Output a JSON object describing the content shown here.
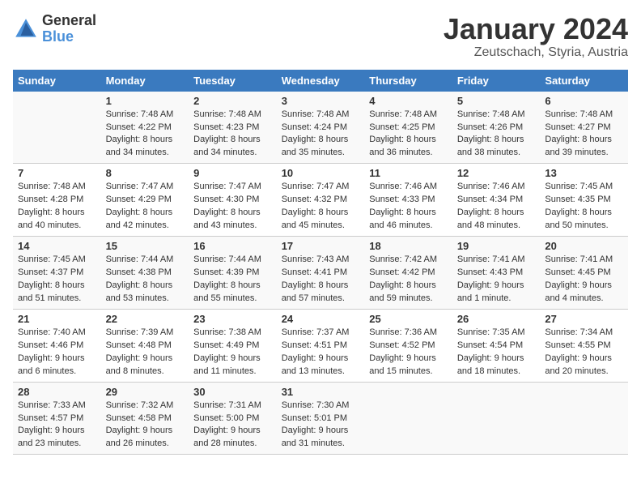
{
  "logo": {
    "general": "General",
    "blue": "Blue"
  },
  "title": "January 2024",
  "location": "Zeutschach, Styria, Austria",
  "days_of_week": [
    "Sunday",
    "Monday",
    "Tuesday",
    "Wednesday",
    "Thursday",
    "Friday",
    "Saturday"
  ],
  "weeks": [
    [
      {
        "day": "",
        "sunrise": "",
        "sunset": "",
        "daylight": ""
      },
      {
        "day": "1",
        "sunrise": "7:48 AM",
        "sunset": "4:22 PM",
        "daylight": "8 hours and 34 minutes."
      },
      {
        "day": "2",
        "sunrise": "7:48 AM",
        "sunset": "4:23 PM",
        "daylight": "8 hours and 34 minutes."
      },
      {
        "day": "3",
        "sunrise": "7:48 AM",
        "sunset": "4:24 PM",
        "daylight": "8 hours and 35 minutes."
      },
      {
        "day": "4",
        "sunrise": "7:48 AM",
        "sunset": "4:25 PM",
        "daylight": "8 hours and 36 minutes."
      },
      {
        "day": "5",
        "sunrise": "7:48 AM",
        "sunset": "4:26 PM",
        "daylight": "8 hours and 38 minutes."
      },
      {
        "day": "6",
        "sunrise": "7:48 AM",
        "sunset": "4:27 PM",
        "daylight": "8 hours and 39 minutes."
      }
    ],
    [
      {
        "day": "7",
        "sunrise": "7:48 AM",
        "sunset": "4:28 PM",
        "daylight": "8 hours and 40 minutes."
      },
      {
        "day": "8",
        "sunrise": "7:47 AM",
        "sunset": "4:29 PM",
        "daylight": "8 hours and 42 minutes."
      },
      {
        "day": "9",
        "sunrise": "7:47 AM",
        "sunset": "4:30 PM",
        "daylight": "8 hours and 43 minutes."
      },
      {
        "day": "10",
        "sunrise": "7:47 AM",
        "sunset": "4:32 PM",
        "daylight": "8 hours and 45 minutes."
      },
      {
        "day": "11",
        "sunrise": "7:46 AM",
        "sunset": "4:33 PM",
        "daylight": "8 hours and 46 minutes."
      },
      {
        "day": "12",
        "sunrise": "7:46 AM",
        "sunset": "4:34 PM",
        "daylight": "8 hours and 48 minutes."
      },
      {
        "day": "13",
        "sunrise": "7:45 AM",
        "sunset": "4:35 PM",
        "daylight": "8 hours and 50 minutes."
      }
    ],
    [
      {
        "day": "14",
        "sunrise": "7:45 AM",
        "sunset": "4:37 PM",
        "daylight": "8 hours and 51 minutes."
      },
      {
        "day": "15",
        "sunrise": "7:44 AM",
        "sunset": "4:38 PM",
        "daylight": "8 hours and 53 minutes."
      },
      {
        "day": "16",
        "sunrise": "7:44 AM",
        "sunset": "4:39 PM",
        "daylight": "8 hours and 55 minutes."
      },
      {
        "day": "17",
        "sunrise": "7:43 AM",
        "sunset": "4:41 PM",
        "daylight": "8 hours and 57 minutes."
      },
      {
        "day": "18",
        "sunrise": "7:42 AM",
        "sunset": "4:42 PM",
        "daylight": "8 hours and 59 minutes."
      },
      {
        "day": "19",
        "sunrise": "7:41 AM",
        "sunset": "4:43 PM",
        "daylight": "9 hours and 1 minute."
      },
      {
        "day": "20",
        "sunrise": "7:41 AM",
        "sunset": "4:45 PM",
        "daylight": "9 hours and 4 minutes."
      }
    ],
    [
      {
        "day": "21",
        "sunrise": "7:40 AM",
        "sunset": "4:46 PM",
        "daylight": "9 hours and 6 minutes."
      },
      {
        "day": "22",
        "sunrise": "7:39 AM",
        "sunset": "4:48 PM",
        "daylight": "9 hours and 8 minutes."
      },
      {
        "day": "23",
        "sunrise": "7:38 AM",
        "sunset": "4:49 PM",
        "daylight": "9 hours and 11 minutes."
      },
      {
        "day": "24",
        "sunrise": "7:37 AM",
        "sunset": "4:51 PM",
        "daylight": "9 hours and 13 minutes."
      },
      {
        "day": "25",
        "sunrise": "7:36 AM",
        "sunset": "4:52 PM",
        "daylight": "9 hours and 15 minutes."
      },
      {
        "day": "26",
        "sunrise": "7:35 AM",
        "sunset": "4:54 PM",
        "daylight": "9 hours and 18 minutes."
      },
      {
        "day": "27",
        "sunrise": "7:34 AM",
        "sunset": "4:55 PM",
        "daylight": "9 hours and 20 minutes."
      }
    ],
    [
      {
        "day": "28",
        "sunrise": "7:33 AM",
        "sunset": "4:57 PM",
        "daylight": "9 hours and 23 minutes."
      },
      {
        "day": "29",
        "sunrise": "7:32 AM",
        "sunset": "4:58 PM",
        "daylight": "9 hours and 26 minutes."
      },
      {
        "day": "30",
        "sunrise": "7:31 AM",
        "sunset": "5:00 PM",
        "daylight": "9 hours and 28 minutes."
      },
      {
        "day": "31",
        "sunrise": "7:30 AM",
        "sunset": "5:01 PM",
        "daylight": "9 hours and 31 minutes."
      },
      {
        "day": "",
        "sunrise": "",
        "sunset": "",
        "daylight": ""
      },
      {
        "day": "",
        "sunrise": "",
        "sunset": "",
        "daylight": ""
      },
      {
        "day": "",
        "sunrise": "",
        "sunset": "",
        "daylight": ""
      }
    ]
  ],
  "labels": {
    "sunrise_prefix": "Sunrise: ",
    "sunset_prefix": "Sunset: ",
    "daylight_prefix": "Daylight: "
  }
}
